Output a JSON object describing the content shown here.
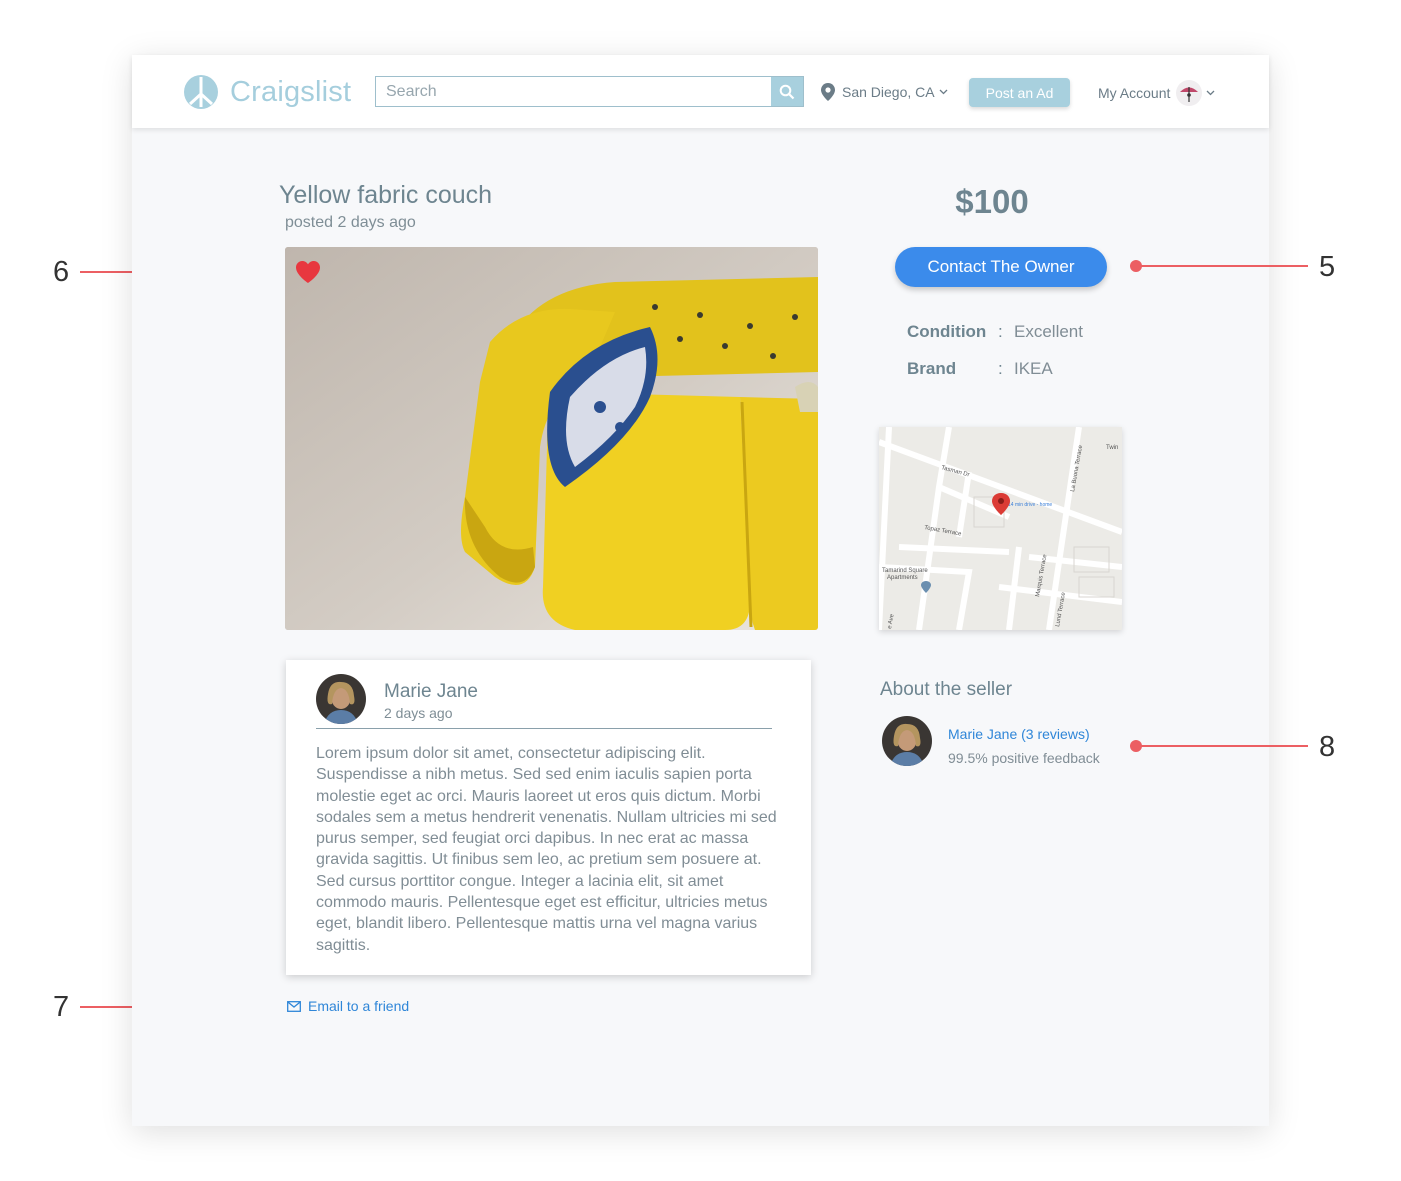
{
  "header": {
    "logo_text": "Craigslist",
    "search_placeholder": "Search",
    "location": "San Diego, CA",
    "post_button": "Post an Ad",
    "account_label": "My Account"
  },
  "listing": {
    "title": "Yellow fabric couch",
    "posted": "posted 2 days ago",
    "price": "$100",
    "contact_button": "Contact The Owner",
    "specs": [
      {
        "label": "Condition",
        "value": "Excellent"
      },
      {
        "label": "Brand",
        "value": "IKEA"
      }
    ]
  },
  "comment": {
    "name": "Marie Jane",
    "time": "2 days ago",
    "body": "Lorem ipsum dolor sit amet, consectetur adipiscing elit. Suspendisse a nibh metus. Sed sed enim iaculis sapien porta molestie eget ac orci. Mauris laoreet ut eros quis dictum. Morbi sodales sem a metus hendrerit venenatis. Nullam ultricies mi sed purus semper, sed feugiat orci dapibus. In nec erat ac massa gravida sagittis. Ut finibus sem leo, ac pretium sem posuere at. Sed cursus porttitor congue. Integer a lacinia elit, sit amet commodo mauris. Pellentesque eget est efficitur, ultricies metus eget, blandit libero. Pellentesque mattis urna vel magna varius sagittis."
  },
  "email_link": "Email to a friend",
  "map": {
    "labels": [
      "Tasman Dr",
      "Topaz Terrace",
      "Tamarind Square",
      "Apartments",
      "La Buona Terrace",
      "Twin",
      "Marquis Terrace",
      "Lund Terrace",
      "e Ave",
      "14 min drive - home"
    ]
  },
  "seller": {
    "section_title": "About the seller",
    "link": "Marie Jane (3 reviews)",
    "feedback": "99.5% positive feedback"
  },
  "annotations": [
    "6",
    "5",
    "7",
    "8"
  ],
  "colors": {
    "accent_light": "#a8d0de",
    "primary_blue": "#3b8beb",
    "link_blue": "#2f86d8",
    "annotation_red": "#ec5f63",
    "heart_red": "#e8373f"
  }
}
